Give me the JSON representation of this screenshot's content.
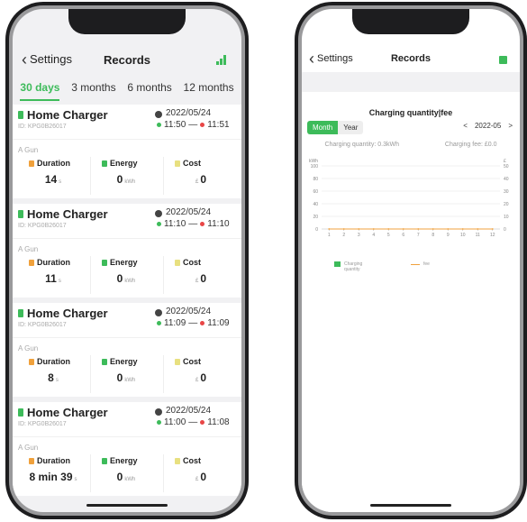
{
  "left_phone": {
    "nav": {
      "back_label": "Settings",
      "title": "Records"
    },
    "tabs": [
      "30 days",
      "3 months",
      "6 months",
      "12 months"
    ],
    "active_tab": 0,
    "records": [
      {
        "name": "Home Charger",
        "id": "ID: KPG0B26017",
        "date": "2022/05/24",
        "start": "11:50",
        "end": "11:51",
        "gun": "A Gun",
        "duration_label": "Duration",
        "duration_value": "14",
        "duration_unit": "s",
        "energy_label": "Energy",
        "energy_value": "0",
        "energy_unit": "kWh",
        "cost_label": "Cost",
        "cost_currency": "£",
        "cost_value": "0"
      },
      {
        "name": "Home Charger",
        "id": "ID: KPG0B26017",
        "date": "2022/05/24",
        "start": "11:10",
        "end": "11:10",
        "gun": "A Gun",
        "duration_label": "Duration",
        "duration_value": "11",
        "duration_unit": "s",
        "energy_label": "Energy",
        "energy_value": "0",
        "energy_unit": "kWh",
        "cost_label": "Cost",
        "cost_currency": "£",
        "cost_value": "0"
      },
      {
        "name": "Home Charger",
        "id": "ID: KPG0B26017",
        "date": "2022/05/24",
        "start": "11:09",
        "end": "11:09",
        "gun": "A Gun",
        "duration_label": "Duration",
        "duration_value": "8",
        "duration_unit": "s",
        "energy_label": "Energy",
        "energy_value": "0",
        "energy_unit": "kWh",
        "cost_label": "Cost",
        "cost_currency": "£",
        "cost_value": "0"
      },
      {
        "name": "Home Charger",
        "id": "ID: KPG0B26017",
        "date": "2022/05/24",
        "start": "11:00",
        "end": "11:08",
        "gun": "A Gun",
        "duration_label": "Duration",
        "duration_value": "8 min 39",
        "duration_unit": "s",
        "energy_label": "Energy",
        "energy_value": "0",
        "energy_unit": "kWh",
        "cost_label": "Cost",
        "cost_currency": "£",
        "cost_value": "0"
      }
    ]
  },
  "right_phone": {
    "nav": {
      "back_label": "Settings",
      "title": "Records"
    },
    "chart_title": "Charging quantity|fee",
    "segments": [
      "Month",
      "Year"
    ],
    "active_segment": 0,
    "month_selector": {
      "prev": "<",
      "value": "2022-05",
      "next": ">"
    },
    "summary": {
      "quantity": "Charging quantity: 0.3kWh",
      "fee": "Charging fee: £0.0"
    }
  },
  "icons": [
    "chevron-left-icon",
    "bar-chart-icon",
    "plug-icon",
    "clock-icon",
    "hourglass-icon",
    "battery-icon",
    "coin-icon",
    "grid-icon"
  ],
  "colors": {
    "accent": "#3dbb5a",
    "end_dot": "#e84646",
    "fee_line": "#f0a13c"
  },
  "chart_data": {
    "type": "bar",
    "categories": [
      "1",
      "2",
      "3",
      "4",
      "5",
      "6",
      "7",
      "8",
      "9",
      "10",
      "11",
      "12"
    ],
    "series": [
      {
        "name": "Charging quantity",
        "values": [
          0,
          0,
          0,
          0,
          0,
          0,
          0,
          0,
          0,
          0,
          0,
          0
        ]
      },
      {
        "name": "fee",
        "values": [
          0,
          0,
          0,
          0,
          0,
          0,
          0,
          0,
          0,
          0,
          0,
          0
        ]
      }
    ],
    "y_left_label": "kWh",
    "y_right_label": "£",
    "y_left_ticks": [
      "0",
      "20",
      "40",
      "60",
      "80",
      "100"
    ],
    "y_right_ticks": [
      "0",
      "10",
      "20",
      "30",
      "40",
      "50"
    ],
    "ylim_left": [
      0,
      100
    ],
    "ylim_right": [
      0,
      50
    ],
    "grid": true,
    "legend_position": "bottom"
  }
}
